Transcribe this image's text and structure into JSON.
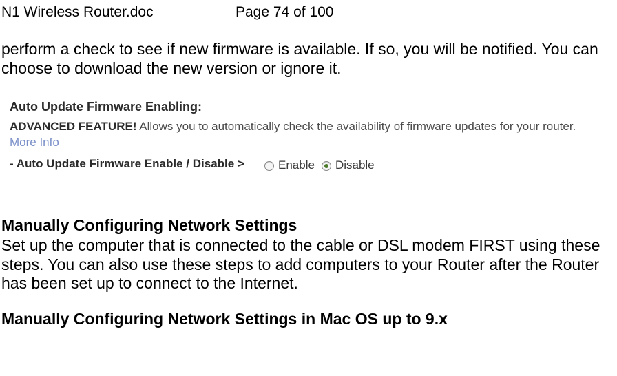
{
  "header": {
    "doc_title": "N1 Wireless Router.doc",
    "page_indicator": "Page 74 of 100"
  },
  "intro_paragraph": "perform a check to see if new firmware is available. If so, you will be notified. You can choose to download the new version or ignore it.",
  "figure": {
    "title": "Auto Update Firmware Enabling:",
    "advanced_prefix": "ADVANCED FEATURE!",
    "advanced_desc": " Allows you to automatically check the availability of firmware updates for your router. ",
    "more_info": "More Info",
    "toggle_label": "- Auto Update Firmware Enable / Disable >",
    "option_enable": "Enable",
    "option_disable": "Disable",
    "selected": "disable"
  },
  "section1": {
    "heading": "Manually Configuring Network Settings",
    "body": "Set up the computer that is connected to the cable or DSL modem FIRST using these steps. You can also use these steps to add computers to your Router after the Router has been set up to connect to the Internet."
  },
  "section2": {
    "heading": "Manually Configuring Network Settings in Mac OS up to 9.x"
  }
}
